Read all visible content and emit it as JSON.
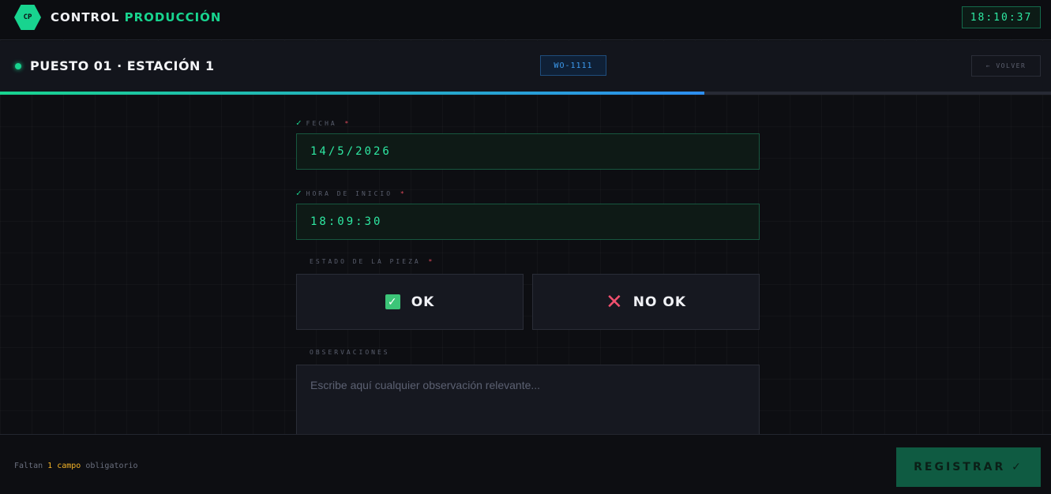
{
  "header": {
    "logo_text": "CP",
    "brand_part1": "CONTROL",
    "brand_part2": "PRODUCCIÓN",
    "clock": "18:10:37"
  },
  "station": {
    "title": "PUESTO 01 · ESTACIÓN 1",
    "work_order": "WO-1111",
    "back_label": "← VOLVER",
    "progress": 0.67
  },
  "form": {
    "fecha": {
      "label": "FECHA",
      "required": "*",
      "check": "✓",
      "value": "14/5/2026"
    },
    "hora": {
      "label": "HORA DE INICIO",
      "required": "*",
      "check": "✓",
      "value": "18:09:30"
    },
    "estado": {
      "label": "ESTADO DE LA PIEZA",
      "required": "*",
      "ok_icon": "✓",
      "ok_label": "OK",
      "nok_icon": "✕",
      "nok_label": "NO OK"
    },
    "observaciones": {
      "label": "OBSERVACIONES",
      "placeholder": "Escribe aquí cualquier observación relevante..."
    }
  },
  "footer": {
    "missing_prefix": "Faltan",
    "missing_count": "1 campo",
    "missing_suffix": "obligatorio",
    "register_label": "REGISTRAR ✓"
  },
  "colors": {
    "accent": "#18d48f",
    "blue": "#2d8ef0",
    "danger": "#f0506e"
  }
}
